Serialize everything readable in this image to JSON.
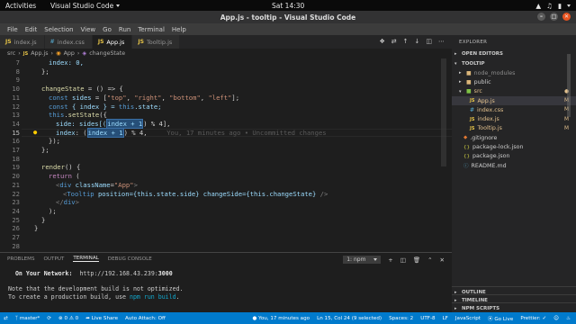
{
  "topbar": {
    "activities": "Activities",
    "app_name": "Visual Studio Code",
    "clock": "Sat 14:30"
  },
  "window": {
    "title": "App.js - tooltip - Visual Studio Code"
  },
  "menu": [
    "File",
    "Edit",
    "Selection",
    "View",
    "Go",
    "Run",
    "Terminal",
    "Help"
  ],
  "tabs": [
    {
      "icon": "JS",
      "label": "index.js"
    },
    {
      "icon": "#",
      "label": "index.css"
    },
    {
      "icon": "JS",
      "label": "App.js"
    },
    {
      "icon": "JS",
      "label": "Tooltip.js"
    }
  ],
  "breadcrumb": [
    "src",
    "App.js",
    "App",
    "changeState"
  ],
  "editor": {
    "line_numbers": [
      "7",
      "8",
      "9",
      "10",
      "11",
      "12",
      "13",
      "14",
      "15",
      "16",
      "17",
      "18",
      "19",
      "20",
      "21",
      "22",
      "23",
      "24",
      "25",
      "26",
      "27",
      "28"
    ],
    "code": {
      "l7": "index: 0,",
      "l8": "};",
      "l10_name": "changeState",
      "l10_rest": " = () => {",
      "l11_kw": "const",
      "l11_var": " sides",
      "l11_eq": " = [",
      "l11_s1": "\"top\"",
      "l11_s2": "\"right\"",
      "l11_s3": "\"bottom\"",
      "l11_s4": "\"left\"",
      "l11_end": "];",
      "l12_kw": "const",
      "l12_mid": " { index } = ",
      "l12_this": "this",
      "l12_end": ".state;",
      "l13_this": "this",
      "l13_dot": ".",
      "l13_fn": "setState",
      "l13_end": "({",
      "l14_key": "side",
      "l14_mid": ": sides[(",
      "l14_hl": "index + 1",
      "l14_end": ") % 4],",
      "l15_key": "index",
      "l15_mid": ": (",
      "l15_hl": "index + 1",
      "l15_end": ") % 4,",
      "l15_blame": "You, 17 minutes ago • Uncommitted changes",
      "l16": "});",
      "l17": "};",
      "l19_fn": "render",
      "l19_end": "() {",
      "l20_kw": "return",
      "l20_end": " (",
      "l21_open": "<",
      "l21_tag": "div",
      "l21_attr": " className",
      "l21_eq": "=",
      "l21_str": "\"App\"",
      "l21_close": ">",
      "l22_open": "<",
      "l22_tag": "Tooltip",
      "l22_attr1": " position",
      "l22_v1": "={this.state.side}",
      "l22_attr2": " changeSide",
      "l22_v2": "={this.changeState}",
      "l22_close": " />",
      "l23_open": "</",
      "l23_tag": "div",
      "l23_close": ">",
      "l24": ");",
      "l25": "}",
      "l26": "}"
    }
  },
  "panel": {
    "tabs": [
      "PROBLEMS",
      "OUTPUT",
      "TERMINAL",
      "DEBUG CONSOLE"
    ],
    "terminal_select": "1: npm",
    "terminal_lines": {
      "network_label": "On Your Network:",
      "network_url": "http://192.168.43.239:",
      "network_port": "3000",
      "note": "Note that the development build is not optimized.",
      "build_prefix": "To create a production build, use ",
      "build_cmd": "npm run build",
      "build_suffix": "."
    }
  },
  "explorer": {
    "title": "EXPLORER",
    "open_editors": "OPEN EDITORS",
    "project": "TOOLTIP",
    "items": [
      {
        "label": "node_modules",
        "type": "folder"
      },
      {
        "label": "public",
        "type": "folder"
      },
      {
        "label": "src",
        "type": "folder-open"
      },
      {
        "label": "App.js",
        "type": "js",
        "badge": "M"
      },
      {
        "label": "index.css",
        "type": "css",
        "badge": "M"
      },
      {
        "label": "index.js",
        "type": "js",
        "badge": "M"
      },
      {
        "label": "Tooltip.js",
        "type": "js",
        "badge": "M"
      },
      {
        "label": ".gitignore",
        "type": "git"
      },
      {
        "label": "package-lock.json",
        "type": "json"
      },
      {
        "label": "package.json",
        "type": "json"
      },
      {
        "label": "README.md",
        "type": "md"
      }
    ],
    "outline": "OUTLINE",
    "timeline": "TIMELINE",
    "npm_scripts": "NPM SCRIPTS"
  },
  "statusbar": {
    "branch": "master*",
    "errors": "0",
    "warnings": "0",
    "live_share": "Live Share",
    "auto_attach": "Auto Attach: Off",
    "blame": "You, 17 minutes ago",
    "position": "Ln 15, Col 24 (9 selected)",
    "spaces": "Spaces: 2",
    "encoding": "UTF-8",
    "eol": "LF",
    "language": "JavaScript",
    "go_live": "Go Live",
    "prettier": "Prettier: ✓"
  },
  "colors": {
    "accent": "#007acc",
    "modified": "#e2c08d",
    "ubuntu_orange": "#e95420"
  }
}
